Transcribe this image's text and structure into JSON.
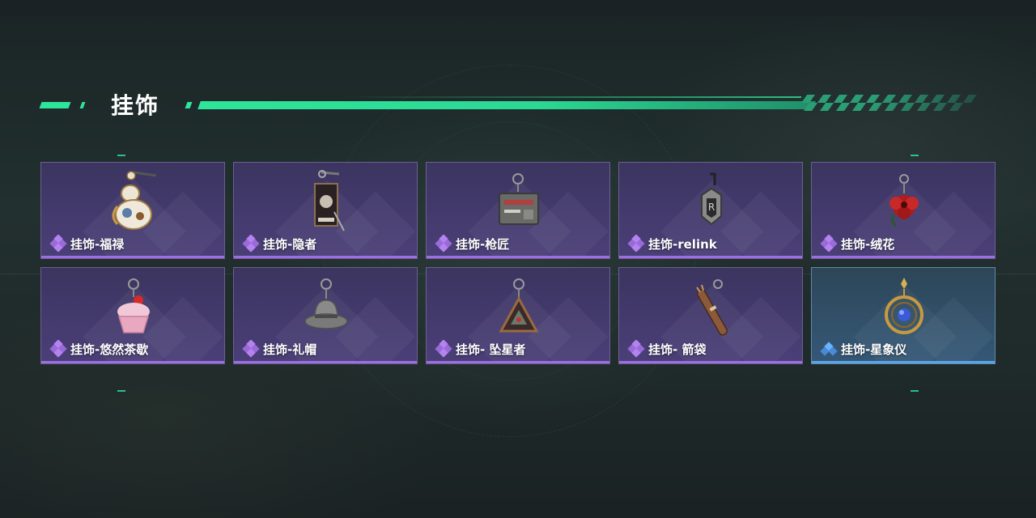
{
  "section": {
    "title": "挂饰"
  },
  "colors": {
    "accent": "#2ee59a",
    "rare_purple": "#9c6ee0",
    "rare_blue": "#5aa4e8"
  },
  "items": [
    {
      "label": "挂饰-福禄",
      "rarity": "purple",
      "icon": "gourd-charm-icon"
    },
    {
      "label": "挂饰-隐者",
      "rarity": "purple",
      "icon": "tarot-card-charm-icon"
    },
    {
      "label": "挂饰-枪匠",
      "rarity": "purple",
      "icon": "gun-case-charm-icon"
    },
    {
      "label": "挂饰-relink",
      "rarity": "purple",
      "icon": "relink-tag-charm-icon"
    },
    {
      "label": "挂饰-绒花",
      "rarity": "purple",
      "icon": "red-flower-charm-icon"
    },
    {
      "label": "挂饰-悠然茶歇",
      "rarity": "purple",
      "icon": "cupcake-charm-icon"
    },
    {
      "label": "挂饰-礼帽",
      "rarity": "purple",
      "icon": "hat-charm-icon"
    },
    {
      "label": "挂饰- 坠星者",
      "rarity": "purple",
      "icon": "triangle-badge-charm-icon"
    },
    {
      "label": "挂饰- 箭袋",
      "rarity": "purple",
      "icon": "quiver-charm-icon"
    },
    {
      "label": "挂饰-星象仪",
      "rarity": "blue",
      "icon": "astrolabe-charm-icon"
    }
  ]
}
